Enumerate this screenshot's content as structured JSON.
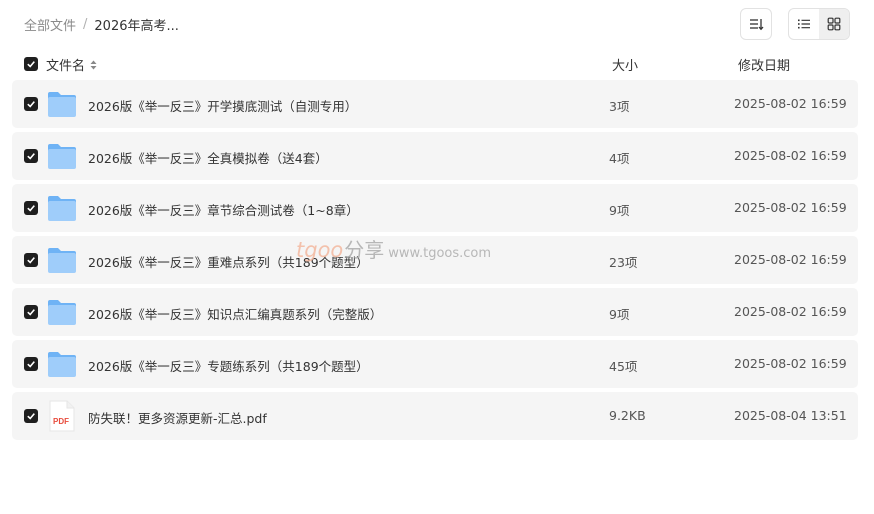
{
  "breadcrumb": {
    "root": "全部文件",
    "separator": "/",
    "current": "2026年高考..."
  },
  "toolbar": {
    "sort_icon": "sort-icon",
    "list_view_icon": "list-view-icon",
    "grid_view_icon": "grid-view-icon"
  },
  "header": {
    "name": "文件名",
    "size": "大小",
    "date": "修改日期"
  },
  "files": [
    {
      "name": "2026版《举一反三》开学摸底测试（自测专用）",
      "size": "3项",
      "date": "2025-08-02 16:59",
      "type": "folder",
      "checked": true
    },
    {
      "name": "2026版《举一反三》全真模拟卷（送4套）",
      "size": "4项",
      "date": "2025-08-02 16:59",
      "type": "folder",
      "checked": true
    },
    {
      "name": "2026版《举一反三》章节综合测试卷（1~8章）",
      "size": "9项",
      "date": "2025-08-02 16:59",
      "type": "folder",
      "checked": true
    },
    {
      "name": "2026版《举一反三》重难点系列（共189个题型）",
      "size": "23项",
      "date": "2025-08-02 16:59",
      "type": "folder",
      "checked": true
    },
    {
      "name": "2026版《举一反三》知识点汇编真题系列（完整版）",
      "size": "9项",
      "date": "2025-08-02 16:59",
      "type": "folder",
      "checked": true
    },
    {
      "name": "2026版《举一反三》专题练系列（共189个题型）",
      "size": "45项",
      "date": "2025-08-02 16:59",
      "type": "folder",
      "checked": true
    },
    {
      "name": "防失联！更多资源更新-汇总.pdf",
      "size": "9.2KB",
      "date": "2025-08-04 13:51",
      "type": "pdf",
      "checked": true
    }
  ],
  "pdf_label": "PDF",
  "watermark": {
    "logo": "tgoo",
    "cn": "分享",
    "url": "www.tgoos.com"
  },
  "colors": {
    "folder": "#6fb3f5",
    "folder_light": "#9fcdfa",
    "pdf_red": "#e84c3d",
    "row_bg": "#f5f5f5",
    "checkbox": "#1f1f1f"
  }
}
